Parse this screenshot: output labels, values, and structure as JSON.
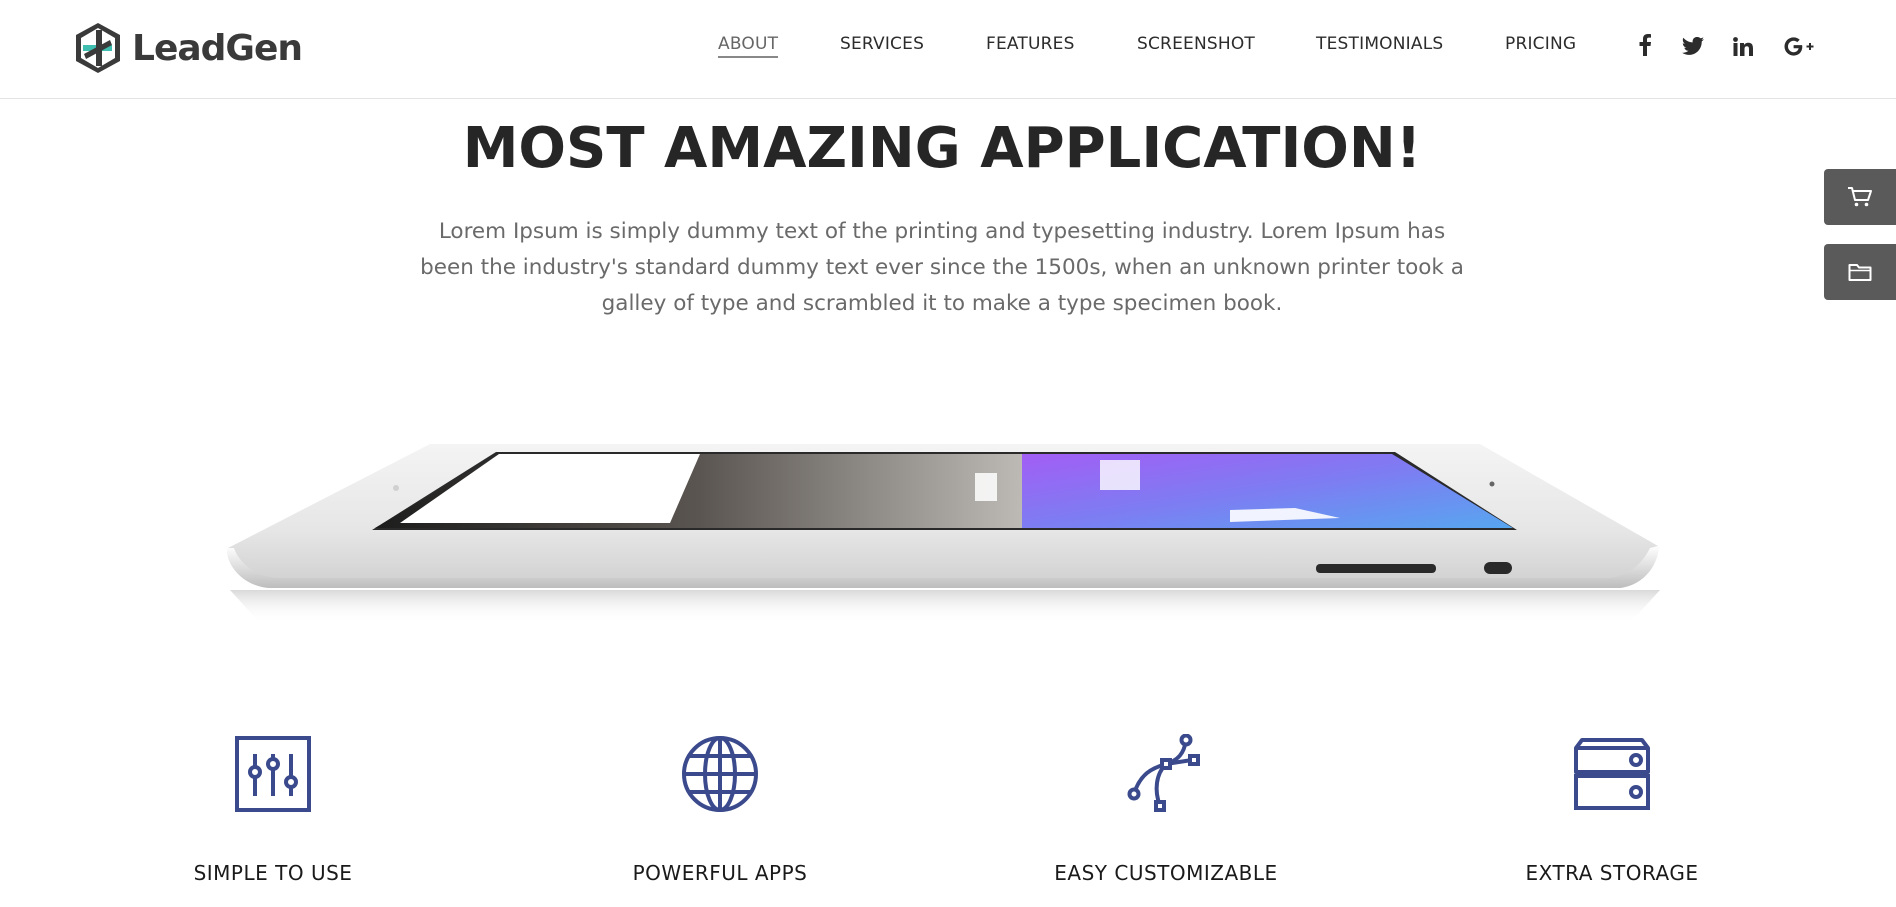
{
  "brand": {
    "name": "LeadGen",
    "accent": "#3a4a8c",
    "logo_teal": "#3fbfb0"
  },
  "nav": {
    "items": [
      {
        "label": "ABOUT",
        "active": true
      },
      {
        "label": "SERVICES",
        "active": false
      },
      {
        "label": "FEATURES",
        "active": false
      },
      {
        "label": "SCREENSHOT",
        "active": false
      },
      {
        "label": "TESTIMONIALS",
        "active": false
      },
      {
        "label": "PRICING",
        "active": false
      }
    ],
    "social": [
      "facebook-icon",
      "twitter-icon",
      "linkedin-icon",
      "google-plus-icon"
    ]
  },
  "side_buttons": [
    "cart-icon",
    "folder-icon"
  ],
  "hero": {
    "title": "MOST AMAZING APPLICATION!",
    "text": "Lorem Ipsum is simply dummy text of the printing and typesetting industry. Lorem Ipsum has been the industry's standard dummy text ever since the 1500s, when an unknown printer took a galley of type and scrambled it to make a type specimen book."
  },
  "features": [
    {
      "title": "SIMPLE TO USE",
      "icon": "sliders-icon"
    },
    {
      "title": "POWERFUL APPS",
      "icon": "globe-icon"
    },
    {
      "title": "EASY CUSTOMIZABLE",
      "icon": "bezier-curve-icon"
    },
    {
      "title": "EXTRA STORAGE",
      "icon": "server-icon"
    }
  ]
}
